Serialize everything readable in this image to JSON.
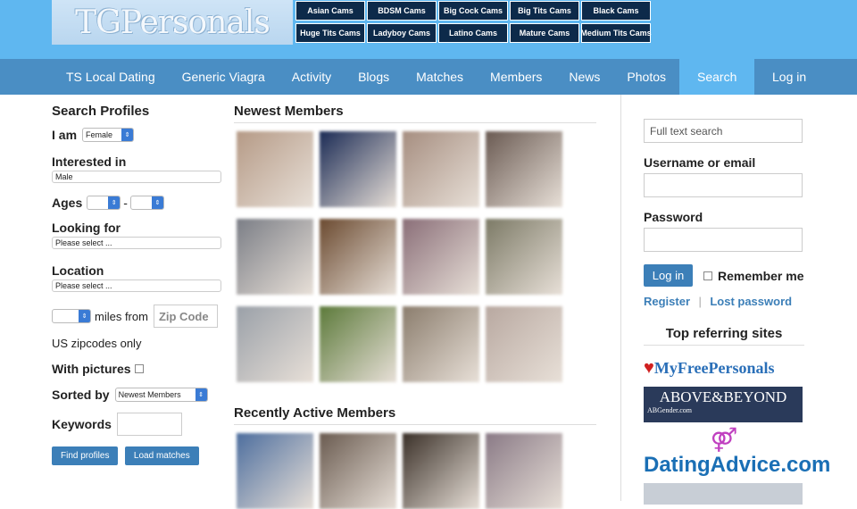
{
  "logo": {
    "text": "TGPersonals"
  },
  "cam_buttons": [
    "Asian Cams",
    "BDSM Cams",
    "Big Cock Cams",
    "Big Tits Cams",
    "Black Cams",
    "Huge Tits Cams",
    "Ladyboy Cams",
    "Latino Cams",
    "Mature Cams",
    "Medium Tits Cams"
  ],
  "nav": {
    "items": [
      "TS Local Dating",
      "Generic Viagra",
      "Activity",
      "Blogs",
      "Matches",
      "Members",
      "News",
      "Photos",
      "Search"
    ],
    "login": "Log in"
  },
  "search": {
    "title": "Search Profiles",
    "i_am_label": "I am",
    "i_am_value": "Female",
    "interested_label": "Interested in",
    "interested_value": "Male",
    "ages_label": "Ages",
    "ages_dash": "-",
    "looking_label": "Looking for",
    "looking_value": "Please select ...",
    "location_label": "Location",
    "location_value": "Please select ...",
    "miles_label": "miles from",
    "zip_placeholder": "Zip Code",
    "us_note": "US zipcodes only",
    "pictures_label": "With pictures",
    "sorted_label": "Sorted by",
    "sorted_value": "Newest Members",
    "keywords_label": "Keywords",
    "find_button": "Find profiles",
    "load_button": "Load matches"
  },
  "newest": {
    "title": "Newest Members",
    "photos": [
      "#b59a86",
      "#1b2b55",
      "#a68e80",
      "#6a5a52",
      "#7b7e86",
      "#6b4a30",
      "#8a6e78",
      "#7c7a66",
      "#9aa0a8",
      "#5c7a3a",
      "#8b7d6d",
      "#b8a8a0"
    ]
  },
  "recent": {
    "title": "Recently Active Members",
    "photos": [
      "#4d6e9e",
      "#6a5b50",
      "#3a3028",
      "#8a7a86"
    ]
  },
  "login": {
    "search_placeholder": "Full text search",
    "username_label": "Username or email",
    "password_label": "Password",
    "login_button": "Log in",
    "remember_label": "Remember me",
    "register_link": "Register",
    "sep": "|",
    "lost_link": "Lost password"
  },
  "referring": {
    "title": "Top referring sites",
    "sites": [
      "MyFreePersonals",
      "ABOVE&BEYOND",
      "ABGender.com",
      "DatingAdvice.com"
    ]
  }
}
